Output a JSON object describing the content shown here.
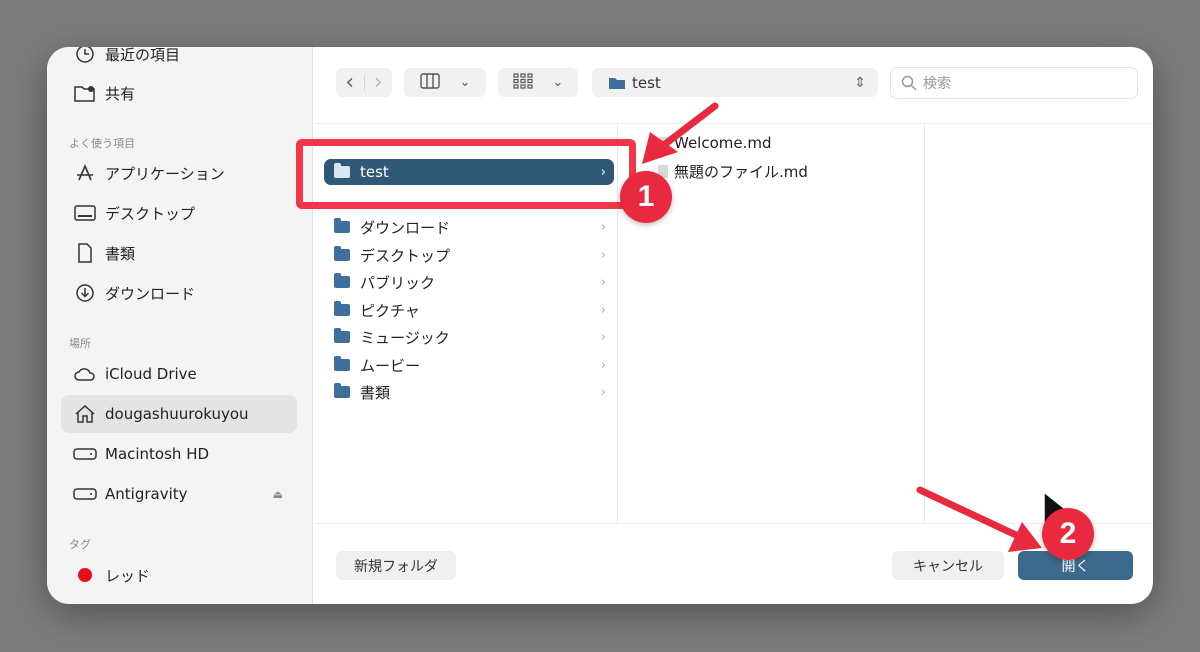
{
  "sidebar": {
    "top_items": [
      {
        "label": "最近の項目",
        "icon": "clock-icon"
      },
      {
        "label": "共有",
        "icon": "shared-folder-icon"
      }
    ],
    "favorites_heading": "よく使う項目",
    "favorites": [
      {
        "label": "アプリケーション",
        "icon": "applications-icon"
      },
      {
        "label": "デスクトップ",
        "icon": "desktop-icon"
      },
      {
        "label": "書類",
        "icon": "document-icon"
      },
      {
        "label": "ダウンロード",
        "icon": "download-icon"
      }
    ],
    "locations_heading": "場所",
    "locations": [
      {
        "label": "iCloud Drive",
        "icon": "cloud-icon"
      },
      {
        "label": "dougashuurokuyou",
        "icon": "home-icon",
        "selected": true
      },
      {
        "label": "Macintosh HD",
        "icon": "disk-icon"
      },
      {
        "label": "Antigravity",
        "icon": "disk-icon",
        "eject": "⏏"
      }
    ],
    "tags_heading": "タグ",
    "tags": [
      {
        "label": "レッド",
        "color": "#e6101c"
      }
    ]
  },
  "toolbar": {
    "back": "‹",
    "forward": "›",
    "view_columns_icon": "columns-view-icon",
    "view_grid_icon": "grid-view-icon",
    "dropdown": "⌄",
    "path_label": "test",
    "path_stepper": "⇕",
    "search_placeholder": "検索"
  },
  "browser": {
    "column1": [
      {
        "label": "test",
        "selected": true
      },
      {
        "label": "ダウンロード"
      },
      {
        "label": "デスクトップ"
      },
      {
        "label": "パブリック"
      },
      {
        "label": "ピクチャ"
      },
      {
        "label": "ミュージック"
      },
      {
        "label": "ムービー"
      },
      {
        "label": "書類"
      }
    ],
    "chevron": "›",
    "column2_files": [
      {
        "label": "Welcome.md"
      },
      {
        "label": "無題のファイル.md"
      }
    ]
  },
  "footer": {
    "new_folder": "新規フォルダ",
    "cancel": "キャンセル",
    "open": "開く"
  },
  "annotations": {
    "step1": "1",
    "step2": "2",
    "color": "#e8293f"
  }
}
